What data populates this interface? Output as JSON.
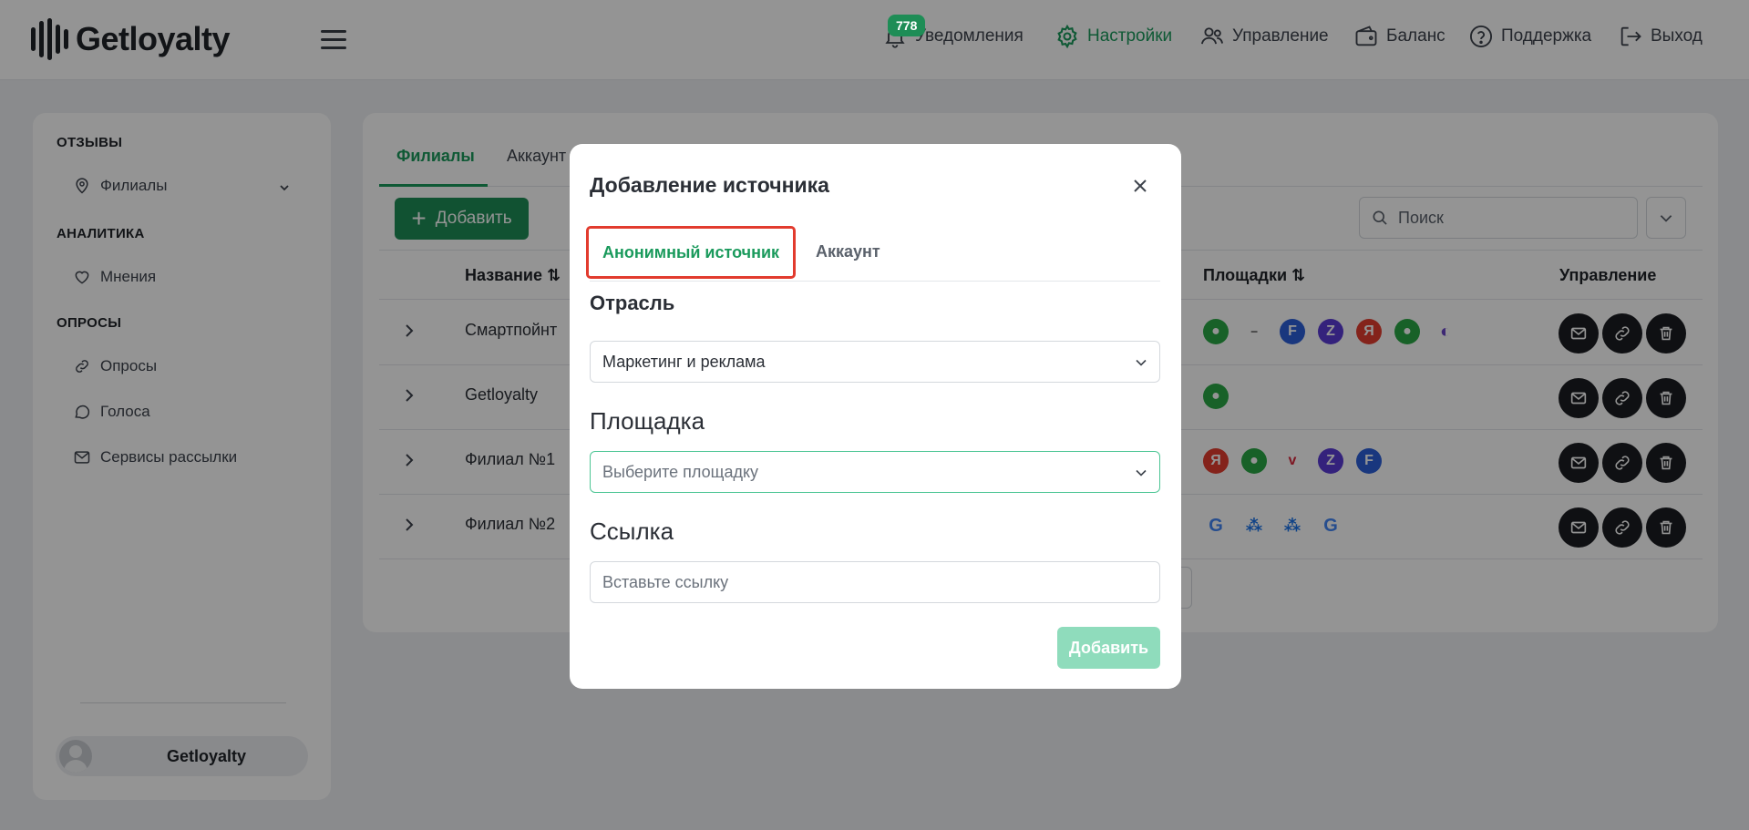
{
  "header": {
    "logo_text": "Getloyalty",
    "notifications_badge": "778",
    "nav": [
      {
        "label": "Уведомления",
        "icon": "bell-icon"
      },
      {
        "label": "Настройки",
        "icon": "gear-icon",
        "active": true
      },
      {
        "label": "Управление",
        "icon": "users-icon"
      },
      {
        "label": "Баланс",
        "icon": "wallet-icon"
      },
      {
        "label": "Поддержка",
        "icon": "help-icon"
      },
      {
        "label": "Выход",
        "icon": "logout-icon"
      }
    ]
  },
  "sidebar": {
    "sections": [
      {
        "title": "ОТЗЫВЫ",
        "items": [
          {
            "label": "Филиалы",
            "icon": "location-pin-icon"
          }
        ]
      },
      {
        "title": "АНАЛИТИКА",
        "items": [
          {
            "label": "Мнения",
            "icon": "heart-icon"
          }
        ]
      },
      {
        "title": "ОПРОСЫ",
        "items": [
          {
            "label": "Опросы",
            "icon": "link-icon"
          },
          {
            "label": "Голоса",
            "icon": "chat-bubble-icon"
          },
          {
            "label": "Сервисы рассылки",
            "icon": "mail-icon"
          }
        ]
      }
    ],
    "profile_name": "Getloyalty"
  },
  "main": {
    "tabs": [
      "Филиалы",
      "Аккаунт"
    ],
    "add_button": "Добавить",
    "search_placeholder": "Поиск",
    "columns": {
      "name": "Название ⇅",
      "platforms": "Площадки ⇅",
      "actions": "Управление"
    },
    "rows": [
      {
        "name": "Смартпойнт",
        "platforms": [
          "2gis",
          "flamp",
          "tripadvisor-f",
          "zoon",
          "yandex",
          "2gis",
          "globe"
        ]
      },
      {
        "name": "Getloyalty",
        "platforms": [
          "2gis"
        ]
      },
      {
        "name": "Филиал №1",
        "platforms": [
          "yandex",
          "2gis",
          "vk-market",
          "zoon",
          "tripadvisor-f"
        ]
      },
      {
        "name": "Филиал №2",
        "platforms": [
          "google",
          "dots",
          "dots",
          "google"
        ]
      }
    ]
  },
  "modal": {
    "title": "Добавление источника",
    "tabs": {
      "anon": "Анонимный источник",
      "account": "Аккаунт"
    },
    "industry_label": "Отрасль",
    "industry_value": "Маркетинг и реклама",
    "platform_label": "Площадка",
    "platform_placeholder": "Выберите площадку",
    "link_label": "Ссылка",
    "link_placeholder": "Вставьте ссылку",
    "submit_label": "Добавить"
  },
  "colors": {
    "accent": "#1a9a5c",
    "highlight": "#e23b2e",
    "disabled_button": "#8fdcbc"
  }
}
